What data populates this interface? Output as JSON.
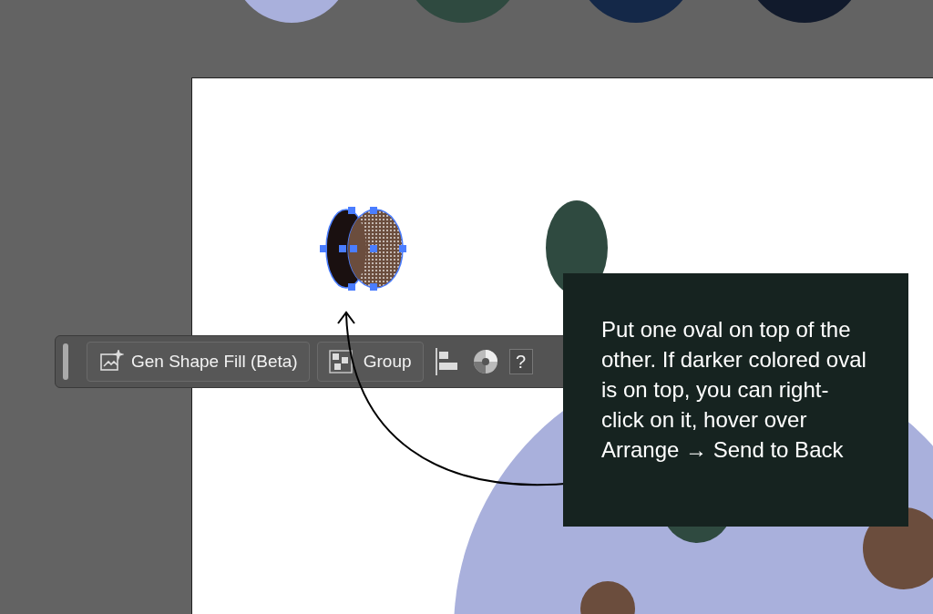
{
  "toolbar": {
    "buttons": [
      {
        "kind": "gen-fill",
        "label": "Gen Shape Fill (Beta)"
      },
      {
        "kind": "group",
        "label": "Group"
      },
      {
        "kind": "align"
      },
      {
        "kind": "color"
      },
      {
        "kind": "help",
        "label": "?"
      }
    ]
  },
  "callout": {
    "text": "Put one oval on top of the other. If darker colored oval is on top, you can right-click on it, hover over Arrange → Send to Back"
  }
}
